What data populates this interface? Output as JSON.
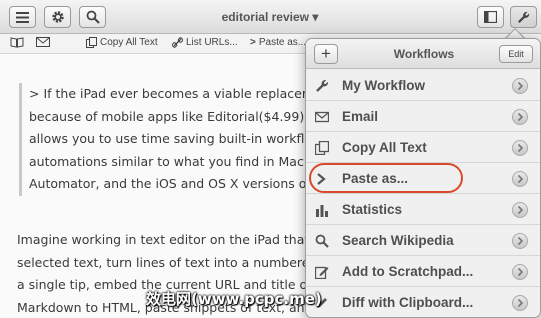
{
  "toolbar": {
    "title": "editorial review ▾",
    "icons": [
      "hamburger-menu-icon",
      "gear-icon",
      "search-icon",
      "bookmark-panel-icon",
      "wrench-icon"
    ]
  },
  "subbar": {
    "items": [
      {
        "icon": "book-icon",
        "label": ""
      },
      {
        "icon": "mail-icon",
        "label": ""
      },
      {
        "icon": "copy-icon",
        "label": "Copy All Text"
      },
      {
        "icon": "link-icon",
        "label": "List URLs..."
      },
      {
        "icon": "chevron-icon",
        "label": "Paste as..."
      }
    ]
  },
  "document": {
    "quote_lines": [
      "> If the iPad ever becomes a viable replacemen",
      "because of mobile apps like Editorial($4.99). T",
      "allows you to use time saving built-in workflov",
      "automations similar to what you find in Mac p",
      "Automator, and the iOS and OS X versions of T"
    ],
    "para_lines": [
      "Imagine working in text editor on the iPad that a",
      "selected text, turn lines of text into a numbered",
      "a single tip, embed the current URL and title of a",
      "Markdown to HTML, paste snippets of text, and c"
    ]
  },
  "workflows": {
    "title": "Workflows",
    "add_label": "+",
    "edit_label": "Edit",
    "items": [
      {
        "label": "My Workflow",
        "icon": "wrench-icon"
      },
      {
        "label": "Email",
        "icon": "mail-icon"
      },
      {
        "label": "Copy All Text",
        "icon": "copy-icon"
      },
      {
        "label": "Paste as...",
        "icon": "chevron-right-icon"
      },
      {
        "label": "Statistics",
        "icon": "bar-chart-icon"
      },
      {
        "label": "Search Wikipedia",
        "icon": "search-icon"
      },
      {
        "label": "Add to Scratchpad...",
        "icon": "edit-icon"
      },
      {
        "label": "Diff with Clipboard...",
        "icon": "pencil-icon"
      }
    ],
    "highlighted": "Paste as...",
    "highlight_color": "#d84a2b"
  },
  "watermark": "效电网(www.pcpc.me)"
}
